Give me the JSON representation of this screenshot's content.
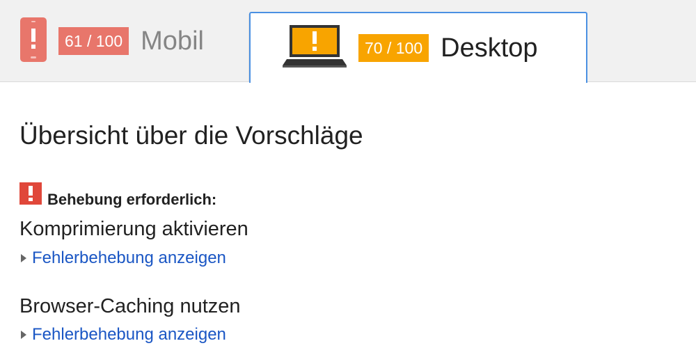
{
  "tabs": {
    "mobile": {
      "score": "61 / 100",
      "label": "Mobil",
      "icon": "phone-warning-icon",
      "color": "#e8766b"
    },
    "desktop": {
      "score": "70 / 100",
      "label": "Desktop",
      "icon": "laptop-warning-icon",
      "color": "#f8a400",
      "active": true
    }
  },
  "summary": {
    "title": "Übersicht über die Vorschläge",
    "severity_label": "Behebung erforderlich:",
    "severity_icon": "warning-icon",
    "severity_color": "#e0473a"
  },
  "rules": [
    {
      "title": "Komprimierung aktivieren",
      "link": "Fehlerbehebung anzeigen"
    },
    {
      "title": "Browser-Caching nutzen",
      "link": "Fehlerbehebung anzeigen"
    }
  ]
}
